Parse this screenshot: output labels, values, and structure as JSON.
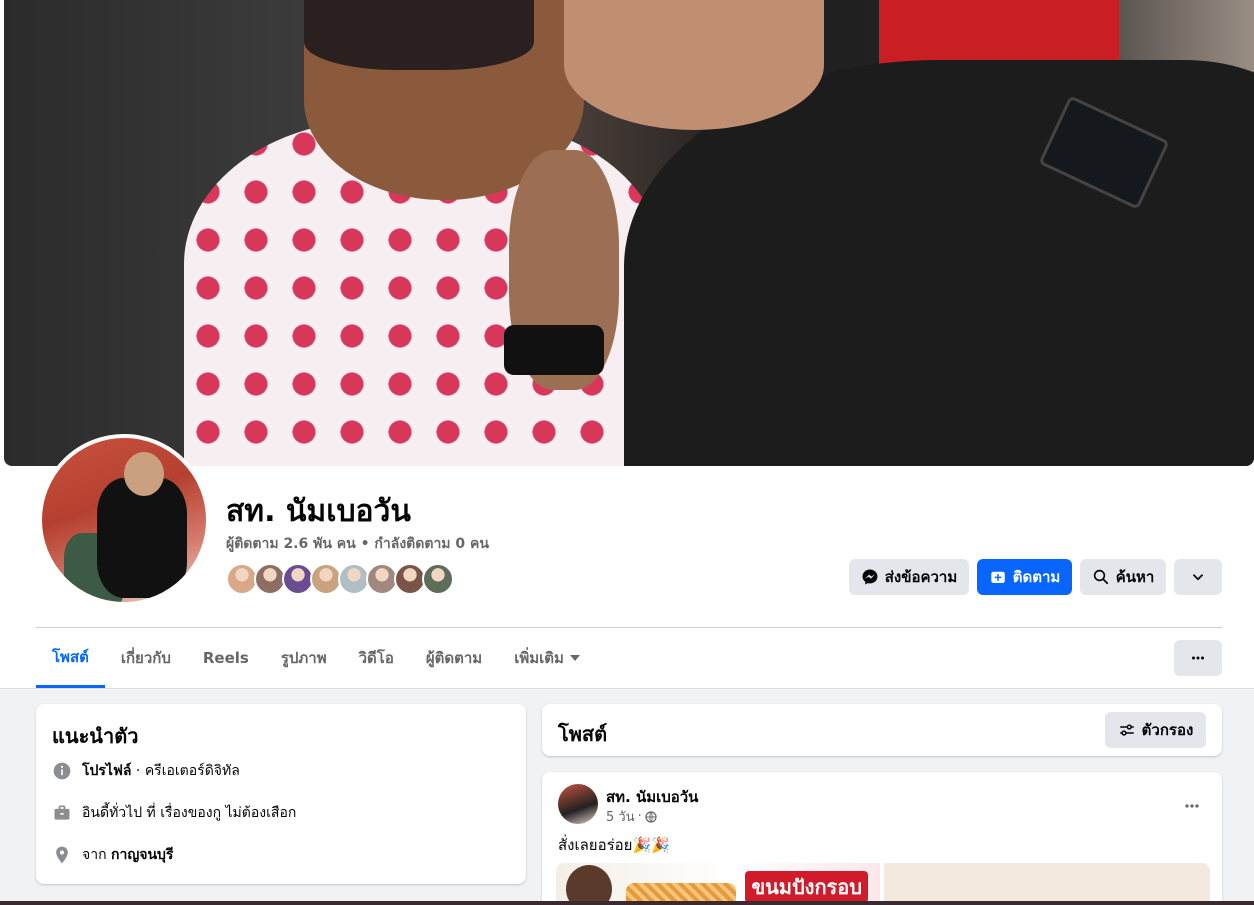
{
  "profile": {
    "name": "สท. นัมเบอวัน",
    "stats": "ผู้ติดตาม 2.6 พัน คน • กำลังติดตาม 0 คน"
  },
  "followers_avatars": [
    "#d7a989",
    "#8d6e63",
    "#6a4c93",
    "#c9a27e",
    "#b0bec5",
    "#a1887f",
    "#795548",
    "#5d6d5a"
  ],
  "actions": {
    "message": "ส่งข้อความ",
    "follow": "ติดตาม",
    "search": "ค้นหา"
  },
  "tabs": [
    {
      "label": "โพสต์",
      "active": true
    },
    {
      "label": "เกี่ยวกับ",
      "active": false
    },
    {
      "label": "Reels",
      "active": false
    },
    {
      "label": "รูปภาพ",
      "active": false
    },
    {
      "label": "วิดีโอ",
      "active": false
    },
    {
      "label": "ผู้ติดตาม",
      "active": false
    },
    {
      "label": "เพิ่มเติม",
      "active": false
    }
  ],
  "intro": {
    "title": "แนะนำตัว",
    "profile_label": "โปรไฟล์",
    "profile_category": " · ครีเอเตอร์ดิจิทัล",
    "bio": "อินดี้ทั่วไป ที่ เรื่องของกู ไม่ต้องเสือก",
    "from_prefix": "จาก ",
    "from_place": "กาญจนบุรี"
  },
  "posts_section": {
    "title": "โพสต์",
    "filter_label": "ตัวกรอง"
  },
  "post": {
    "author": "สท. นัมเบอวัน",
    "time": "5 วัน",
    "text": "สั่งเลยอร่อย🎉🎉",
    "image_title": "ขนมปังกรอบ"
  },
  "colors": {
    "accent": "#0866ff",
    "secondary_text": "#65676b",
    "feed_background": "#f0f2f5",
    "button_grey": "#e4e6eb"
  }
}
